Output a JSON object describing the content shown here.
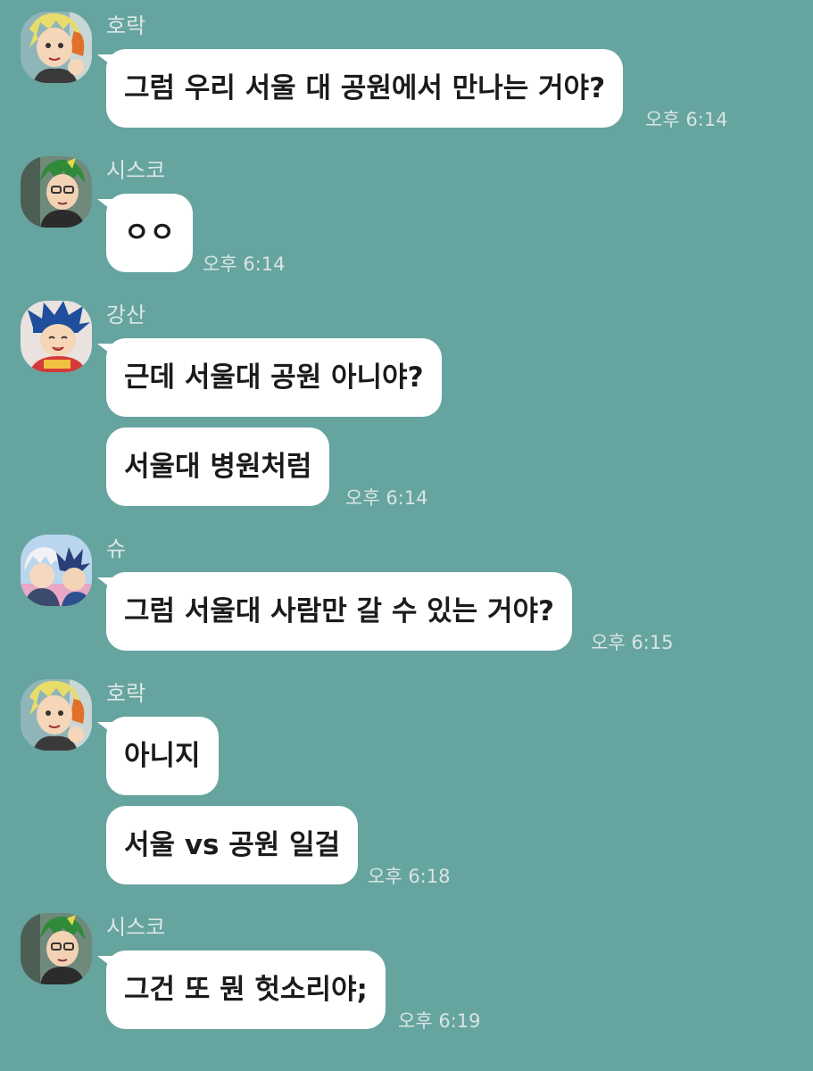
{
  "messages": [
    {
      "sender": "호락",
      "avatar_icon": "horak-avatar-icon",
      "bubbles": [
        "그럼 우리 서울 대 공원에서 만나는 거야?"
      ],
      "time": "오후 6:14"
    },
    {
      "sender": "시스코",
      "avatar_icon": "sisco-avatar-icon",
      "bubbles": [
        "ㅇㅇ"
      ],
      "time": "오후 6:14"
    },
    {
      "sender": "강산",
      "avatar_icon": "gangsan-avatar-icon",
      "bubbles": [
        "근데 서울대 공원 아니야?",
        "서울대 병원처럼"
      ],
      "time": "오후 6:14"
    },
    {
      "sender": "슈",
      "avatar_icon": "shu-avatar-icon",
      "bubbles": [
        "그럼 서울대 사람만 갈 수 있는 거야?"
      ],
      "time": "오후 6:15"
    },
    {
      "sender": "호락",
      "avatar_icon": "horak-avatar-icon",
      "bubbles": [
        "아니지",
        "서울 vs 공원 일걸"
      ],
      "time": "오후 6:18"
    },
    {
      "sender": "시스코",
      "avatar_icon": "sisco-avatar-icon",
      "bubbles": [
        "그건 또 뭔 헛소리야;"
      ],
      "time": "오후 6:19"
    }
  ],
  "colors": {
    "background": "#66a49f",
    "bubble": "#ffffff",
    "text": "#1b1b1b",
    "meta_text": "#d9e5e3"
  }
}
